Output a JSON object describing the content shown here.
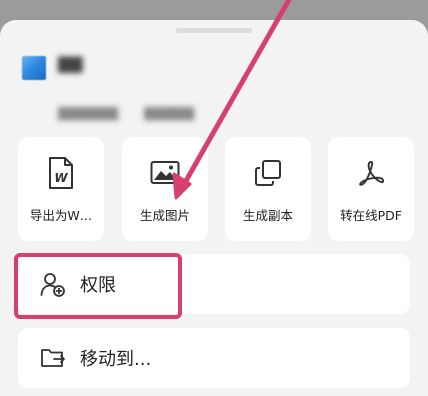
{
  "file": {
    "icon": "blue-doc-icon",
    "name": "▇▇",
    "meta": "▇▇▇▇▇▇ ▇▇▇▇▇"
  },
  "actions": [
    {
      "label": "导出为W…",
      "icon": "word-doc-icon"
    },
    {
      "label": "生成图片",
      "icon": "image-icon"
    },
    {
      "label": "生成副本",
      "icon": "copy-icon"
    },
    {
      "label": "转在线PDF",
      "icon": "pdf-icon"
    }
  ],
  "menu": [
    {
      "label": "权限",
      "icon": "user-add-icon"
    },
    {
      "label": "移动到...",
      "icon": "move-folder-icon"
    }
  ],
  "colors": {
    "overlay": "#9b9b9b",
    "sheet": "#f3f3f3",
    "card": "#ffffff",
    "annotation": "#d7406e"
  }
}
